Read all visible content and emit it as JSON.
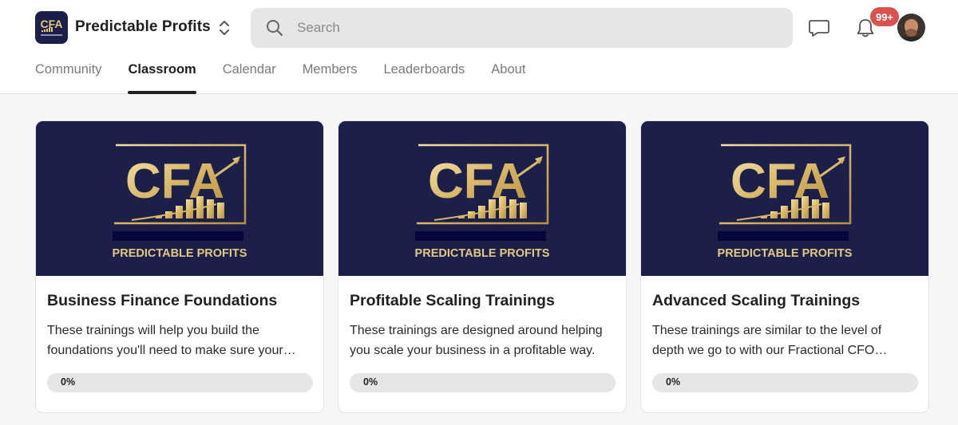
{
  "header": {
    "group_name": "Predictable Profits",
    "logo_text": "CFA",
    "search_placeholder": "Search",
    "notification_count": "99+"
  },
  "tabs": [
    {
      "label": "Community",
      "active": false
    },
    {
      "label": "Classroom",
      "active": true
    },
    {
      "label": "Calendar",
      "active": false
    },
    {
      "label": "Members",
      "active": false
    },
    {
      "label": "Leaderboards",
      "active": false
    },
    {
      "label": "About",
      "active": false
    }
  ],
  "courses": [
    {
      "image_logo": "CFA",
      "image_caption": "PREDICTABLE PROFITS",
      "title": "Business Finance Foundations",
      "description": "These trainings will help you build the foundations you'll need to make sure your business runs smoothly.",
      "progress_label": "0%",
      "progress": 0
    },
    {
      "image_logo": "CFA",
      "image_caption": "PREDICTABLE PROFITS",
      "title": "Profitable Scaling Trainings",
      "description": "These trainings are designed around helping you scale your business in a profitable way.",
      "progress_label": "0%",
      "progress": 0
    },
    {
      "image_logo": "CFA",
      "image_caption": "PREDICTABLE PROFITS",
      "title": "Advanced Scaling Trainings",
      "description": "These trainings are similar to the level of depth we go to with our Fractional CFO clients.",
      "progress_label": "0%",
      "progress": 0
    }
  ],
  "colors": {
    "brand_navy": "#1d1f4b",
    "gold": "#e2c980",
    "badge_red": "#d9534f",
    "search_bg": "#e6e6e6"
  },
  "icons": {
    "switcher": "chevron-up-down-icon",
    "search": "search-icon",
    "chat": "chat-bubble-icon",
    "notifications": "bell-icon"
  }
}
